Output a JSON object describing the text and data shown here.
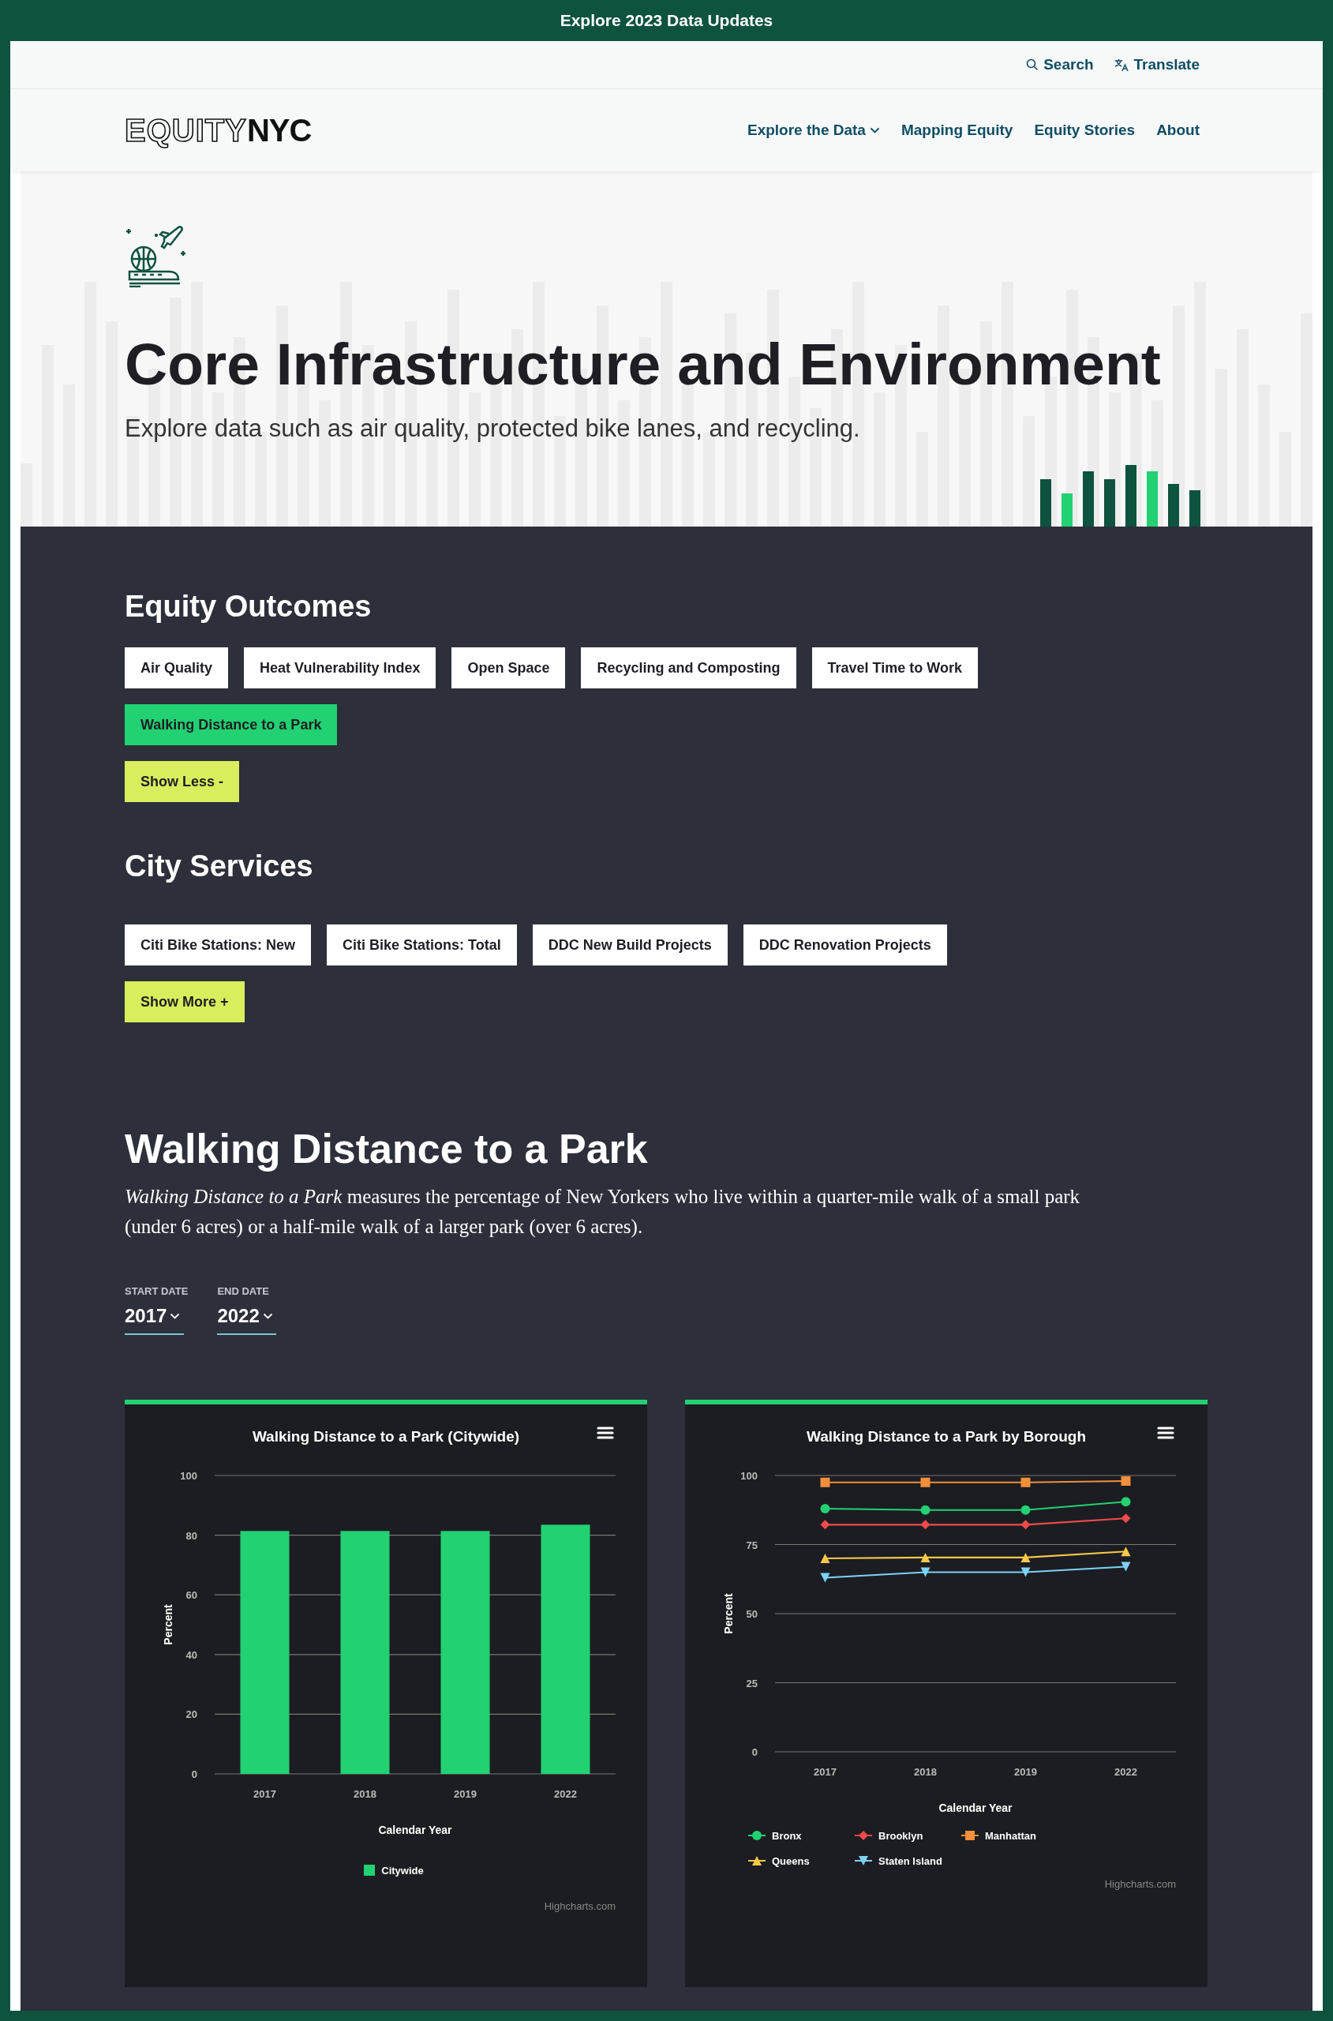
{
  "banner": {
    "text": "Explore 2023 Data Updates"
  },
  "utility_nav": [
    {
      "label": "Search",
      "kind": "search"
    },
    {
      "label": "Translate",
      "kind": "translate"
    }
  ],
  "logo": {
    "outline_text": "EQUITY",
    "solid_text": "NYC"
  },
  "main_nav": [
    {
      "label": "Explore the Data",
      "has_dropdown": true
    },
    {
      "label": "Mapping Equity",
      "has_dropdown": false
    },
    {
      "label": "Equity Stories",
      "has_dropdown": false
    },
    {
      "label": "About",
      "has_dropdown": false
    }
  ],
  "hero": {
    "title": "Core Infrastructure and Environment",
    "subtitle": "Explore data such as air quality, protected bike lanes, and recycling."
  },
  "categories": [
    {
      "heading": "Equity Outcomes",
      "items": [
        {
          "label": "Air Quality",
          "selected": false
        },
        {
          "label": "Heat Vulnerability Index",
          "selected": false
        },
        {
          "label": "Open Space",
          "selected": false
        },
        {
          "label": "Recycling and Composting",
          "selected": false
        },
        {
          "label": "Travel Time to Work",
          "selected": false
        },
        {
          "label": "Walking Distance to a Park",
          "selected": true
        }
      ],
      "toggle": "Show Less -"
    },
    {
      "heading": "City Services",
      "items": [
        {
          "label": "Citi Bike Stations: New",
          "selected": false
        },
        {
          "label": "Citi Bike Stations: Total",
          "selected": false
        },
        {
          "label": "DDC New Build Projects",
          "selected": false
        },
        {
          "label": "DDC Renovation Projects",
          "selected": false
        }
      ],
      "toggle": "Show More +"
    }
  ],
  "indicator": {
    "title": "Walking Distance to a Park",
    "description": "*Walking Distance to a Park* measures the percentage of New Yorkers who live within a quarter-mile walk of a small park (under 6 acres) or a half-mile walk of a larger park (over 6 acres).",
    "date_filters": [
      {
        "label": "START DATE",
        "value": "2017"
      },
      {
        "label": "END DATE",
        "value": "2022"
      }
    ]
  },
  "charts": [
    {
      "credit": "Highcharts.com",
      "chart_data": {
        "type": "bar",
        "title": "Walking Distance to a Park (Citywide)",
        "xlabel": "Calendar Year",
        "ylabel": "Percent",
        "categories": [
          "2017",
          "2018",
          "2019",
          "2022"
        ],
        "ylim": [
          0,
          100
        ],
        "yticks": [
          0,
          20,
          40,
          60,
          80,
          100
        ],
        "grid": true,
        "series": [
          {
            "name": "Citywide",
            "color": "#22d172",
            "values": [
              81.4,
              81.4,
              81.4,
              83.5
            ]
          }
        ]
      }
    },
    {
      "credit": "Highcharts.com",
      "chart_data": {
        "type": "line",
        "title": "Walking Distance to a Park by Borough",
        "xlabel": "Calendar Year",
        "ylabel": "Percent",
        "categories": [
          "2017",
          "2018",
          "2019",
          "2022"
        ],
        "ylim": [
          0,
          100
        ],
        "yticks": [
          0,
          25,
          50,
          75,
          100
        ],
        "grid": true,
        "series": [
          {
            "name": "Bronx",
            "color": "#22d172",
            "marker": "circle",
            "values": [
              88,
              87.5,
              87.5,
              90.5
            ]
          },
          {
            "name": "Brooklyn",
            "color": "#f04a4a",
            "marker": "diamond",
            "values": [
              82.2,
              82.2,
              82.2,
              84.5
            ]
          },
          {
            "name": "Manhattan",
            "color": "#f28f3b",
            "marker": "square",
            "values": [
              97.5,
              97.5,
              97.5,
              98
            ]
          },
          {
            "name": "Queens",
            "color": "#f7c948",
            "marker": "triangle",
            "values": [
              70,
              70.3,
              70.3,
              72.5
            ]
          },
          {
            "name": "Staten Island",
            "color": "#7cd3f7",
            "marker": "triangle-down",
            "values": [
              63,
              65,
              65,
              67
            ]
          }
        ]
      }
    }
  ]
}
